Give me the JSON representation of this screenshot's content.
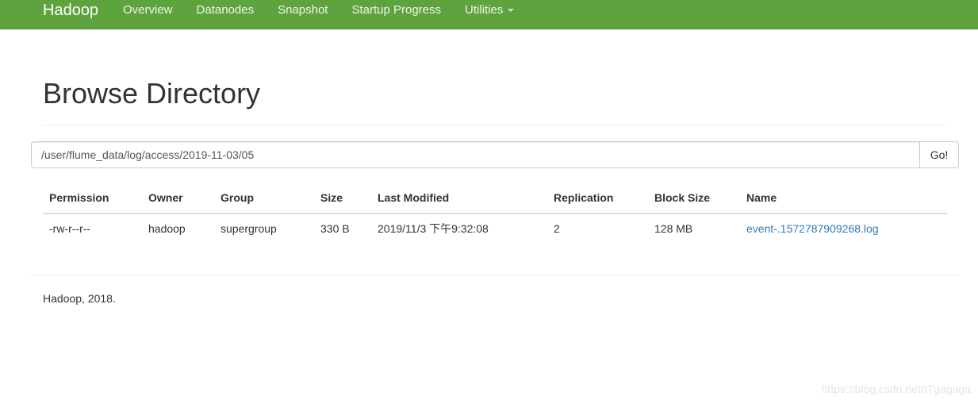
{
  "navbar": {
    "brand": "Hadoop",
    "items": [
      {
        "label": "Overview"
      },
      {
        "label": "Datanodes"
      },
      {
        "label": "Snapshot"
      },
      {
        "label": "Startup Progress"
      },
      {
        "label": "Utilities"
      }
    ],
    "background_color": "#5fa33e"
  },
  "main": {
    "title": "Browse Directory",
    "path_value": "/user/flume_data/log/access/2019-11-03/05",
    "go_label": "Go!"
  },
  "table": {
    "columns": [
      "Permission",
      "Owner",
      "Group",
      "Size",
      "Last Modified",
      "Replication",
      "Block Size",
      "Name"
    ],
    "rows": [
      {
        "permission": "-rw-r--r--",
        "owner": "hadoop",
        "group": "supergroup",
        "size": "330 B",
        "last_modified": "2019/11/3 下午9:32:08",
        "replication": "2",
        "block_size": "128 MB",
        "name": "event-.1572787909268.log"
      }
    ]
  },
  "footer": {
    "text": "Hadoop, 2018."
  },
  "watermark": "https://blog.csdn.net/ITgagaga",
  "colors": {
    "link": "#337ab7"
  }
}
